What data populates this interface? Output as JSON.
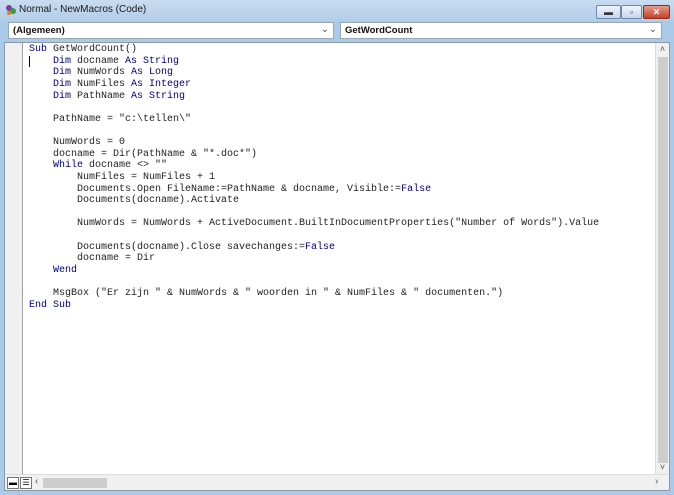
{
  "window": {
    "title": "Normal - NewMacros (Code)",
    "minimize_icon": "minimize-icon",
    "restore_icon": "restore-icon",
    "close_icon": "close-icon"
  },
  "object_combo": {
    "value": "(Algemeen)"
  },
  "procedure_combo": {
    "value": "GetWordCount"
  },
  "colors": {
    "keyword": "#00007f",
    "text": "#222222"
  },
  "code": [
    [
      [
        "Sub",
        "k"
      ],
      [
        " GetWordCount()",
        "t"
      ]
    ],
    [
      [
        "    ",
        "t"
      ],
      [
        "Dim",
        "k"
      ],
      [
        " docname ",
        "t"
      ],
      [
        "As String",
        "k"
      ]
    ],
    [
      [
        "    ",
        "t"
      ],
      [
        "Dim",
        "k"
      ],
      [
        " NumWords ",
        "t"
      ],
      [
        "As Long",
        "k"
      ]
    ],
    [
      [
        "    ",
        "t"
      ],
      [
        "Dim",
        "k"
      ],
      [
        " NumFiles ",
        "t"
      ],
      [
        "As Integer",
        "k"
      ]
    ],
    [
      [
        "    ",
        "t"
      ],
      [
        "Dim",
        "k"
      ],
      [
        " PathName ",
        "t"
      ],
      [
        "As String",
        "k"
      ]
    ],
    [],
    [
      [
        "    PathName = \"c:\\tellen\\\"",
        "t"
      ]
    ],
    [],
    [
      [
        "    NumWords = 0",
        "t"
      ]
    ],
    [
      [
        "    docname = Dir(PathName & \"*.doc*\")",
        "t"
      ]
    ],
    [
      [
        "    ",
        "t"
      ],
      [
        "While",
        "k"
      ],
      [
        " docname <> \"\"",
        "t"
      ]
    ],
    [
      [
        "        NumFiles = NumFiles + 1",
        "t"
      ]
    ],
    [
      [
        "        Documents.Open FileName:=PathName & docname, Visible:=",
        "t"
      ],
      [
        "False",
        "k"
      ]
    ],
    [
      [
        "        Documents(docname).Activate",
        "t"
      ]
    ],
    [],
    [
      [
        "        NumWords = NumWords + ActiveDocument.BuiltInDocumentProperties(\"Number of Words\").Value",
        "t"
      ]
    ],
    [],
    [
      [
        "        Documents(docname).Close savechanges:=",
        "t"
      ],
      [
        "False",
        "k"
      ]
    ],
    [
      [
        "        docname = Dir",
        "t"
      ]
    ],
    [
      [
        "    ",
        "t"
      ],
      [
        "Wend",
        "k"
      ]
    ],
    [],
    [
      [
        "    MsgBox (\"Er zijn \" & NumWords & \" woorden in \" & NumFiles & \" documenten.\")",
        "t"
      ]
    ],
    [
      [
        "End Sub",
        "k"
      ]
    ]
  ]
}
